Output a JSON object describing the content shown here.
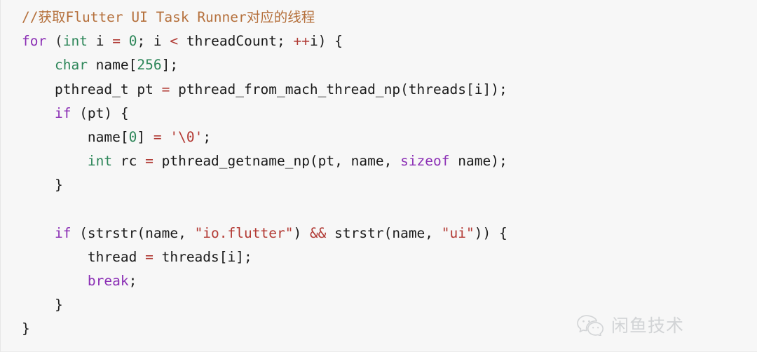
{
  "page": {
    "kind": "code-snippet-image",
    "background_color": "#f7f7f7",
    "language": "objective-c"
  },
  "theme": {
    "comment_color": "#b5703c",
    "keyword_color": "#8b2fb5",
    "type_color": "#2d8659",
    "number_color": "#2d8659",
    "string_color": "#b33a34",
    "operator_color": "#b03a34",
    "plain_color": "#1a1a1a"
  },
  "code": {
    "lines": [
      {
        "indent": 0,
        "tokens": [
          {
            "t": "//获取Flutter UI Task Runner对应的线程",
            "c": "comment"
          }
        ]
      },
      {
        "indent": 0,
        "tokens": [
          {
            "t": "for",
            "c": "keyword"
          },
          {
            "t": " (",
            "c": "punct"
          },
          {
            "t": "int",
            "c": "type"
          },
          {
            "t": " i ",
            "c": "plain"
          },
          {
            "t": "=",
            "c": "operator"
          },
          {
            "t": " ",
            "c": "plain"
          },
          {
            "t": "0",
            "c": "number"
          },
          {
            "t": "; i ",
            "c": "plain"
          },
          {
            "t": "<",
            "c": "operator"
          },
          {
            "t": " threadCount; ",
            "c": "plain"
          },
          {
            "t": "++",
            "c": "operator"
          },
          {
            "t": "i) {",
            "c": "plain"
          }
        ]
      },
      {
        "indent": 1,
        "tokens": [
          {
            "t": "char",
            "c": "type"
          },
          {
            "t": " name[",
            "c": "plain"
          },
          {
            "t": "256",
            "c": "number"
          },
          {
            "t": "];",
            "c": "plain"
          }
        ]
      },
      {
        "indent": 1,
        "tokens": [
          {
            "t": "pthread_t pt ",
            "c": "plain"
          },
          {
            "t": "=",
            "c": "operator"
          },
          {
            "t": " pthread_from_mach_thread_np(threads[i]);",
            "c": "plain"
          }
        ]
      },
      {
        "indent": 1,
        "tokens": [
          {
            "t": "if",
            "c": "keyword"
          },
          {
            "t": " (pt) {",
            "c": "plain"
          }
        ]
      },
      {
        "indent": 2,
        "tokens": [
          {
            "t": "name[",
            "c": "plain"
          },
          {
            "t": "0",
            "c": "number"
          },
          {
            "t": "] ",
            "c": "plain"
          },
          {
            "t": "=",
            "c": "operator"
          },
          {
            "t": " ",
            "c": "plain"
          },
          {
            "t": "'\\0'",
            "c": "string"
          },
          {
            "t": ";",
            "c": "plain"
          }
        ]
      },
      {
        "indent": 2,
        "tokens": [
          {
            "t": "int",
            "c": "type"
          },
          {
            "t": " rc ",
            "c": "plain"
          },
          {
            "t": "=",
            "c": "operator"
          },
          {
            "t": " pthread_getname_np(pt, name, ",
            "c": "plain"
          },
          {
            "t": "sizeof",
            "c": "keyword"
          },
          {
            "t": " name);",
            "c": "plain"
          }
        ]
      },
      {
        "indent": 1,
        "tokens": [
          {
            "t": "}",
            "c": "plain"
          }
        ]
      },
      {
        "indent": 0,
        "tokens": []
      },
      {
        "indent": 1,
        "tokens": [
          {
            "t": "if",
            "c": "keyword"
          },
          {
            "t": " (strstr(name, ",
            "c": "plain"
          },
          {
            "t": "\"io.flutter\"",
            "c": "string"
          },
          {
            "t": ") ",
            "c": "plain"
          },
          {
            "t": "&&",
            "c": "operator"
          },
          {
            "t": " strstr(name, ",
            "c": "plain"
          },
          {
            "t": "\"ui\"",
            "c": "string"
          },
          {
            "t": ")) {",
            "c": "plain"
          }
        ]
      },
      {
        "indent": 2,
        "tokens": [
          {
            "t": "thread ",
            "c": "plain"
          },
          {
            "t": "=",
            "c": "operator"
          },
          {
            "t": " threads[i];",
            "c": "plain"
          }
        ]
      },
      {
        "indent": 2,
        "tokens": [
          {
            "t": "break",
            "c": "keyword"
          },
          {
            "t": ";",
            "c": "plain"
          }
        ]
      },
      {
        "indent": 1,
        "tokens": [
          {
            "t": "}",
            "c": "plain"
          }
        ]
      },
      {
        "indent": 0,
        "tokens": [
          {
            "t": "}",
            "c": "plain"
          }
        ]
      }
    ],
    "plain_text": "//获取Flutter UI Task Runner对应的线程\nfor (int i = 0; i < threadCount; ++i) {\n    char name[256];\n    pthread_t pt = pthread_from_mach_thread_np(threads[i]);\n    if (pt) {\n        name[0] = '\\0';\n        int rc = pthread_getname_np(pt, name, sizeof name);\n    }\n\n    if (strstr(name, \"io.flutter\") && strstr(name, \"ui\")) {\n        thread = threads[i];\n        break;\n    }\n}"
  },
  "watermark": {
    "icon": "wechat-logo-icon",
    "text": "闲鱼技术",
    "text_color": "#d2d4d6"
  }
}
